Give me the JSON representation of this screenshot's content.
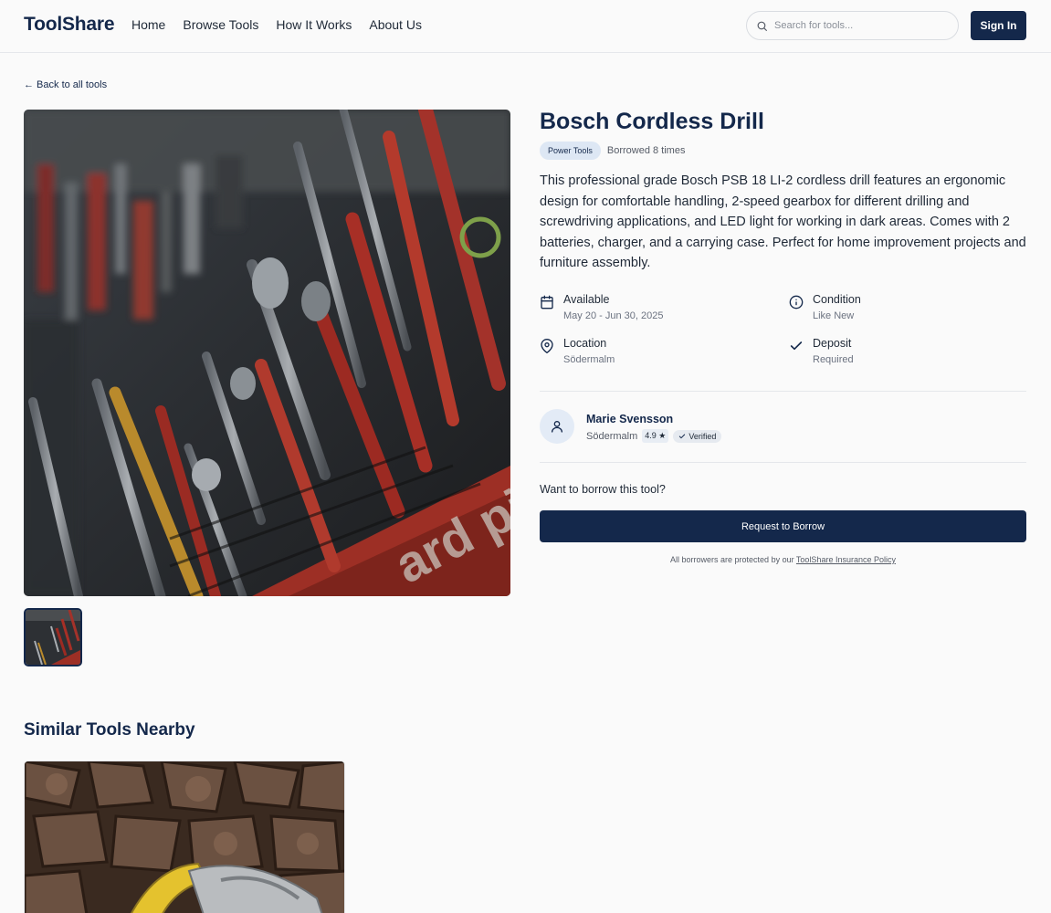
{
  "header": {
    "logo": "ToolShare",
    "nav": [
      {
        "label": "Home"
      },
      {
        "label": "Browse Tools"
      },
      {
        "label": "How It Works"
      },
      {
        "label": "About Us"
      }
    ],
    "search_placeholder": "Search for tools...",
    "sign_in": "Sign In"
  },
  "back_link": "← Back to all tools",
  "tool": {
    "title": "Bosch Cordless Drill",
    "category": "Power Tools",
    "borrowed": "Borrowed 8 times",
    "description": "This professional grade Bosch PSB 18 LI-2 cordless drill features an ergonomic design for comfortable handling, 2-speed gearbox for different drilling and screwdriving applications, and LED light for working in dark areas. Comes with 2 batteries, charger, and a carrying case. Perfect for home improvement projects and furniture assembly.",
    "features": {
      "available": {
        "label": "Available",
        "value": "May 20 - Jun 30, 2025",
        "icon": "calendar-icon"
      },
      "condition": {
        "label": "Condition",
        "value": "Like New",
        "icon": "info-icon"
      },
      "location": {
        "label": "Location",
        "value": "Södermalm",
        "icon": "map-pin-icon"
      },
      "deposit": {
        "label": "Deposit",
        "value": "Required",
        "icon": "check-icon"
      }
    }
  },
  "owner": {
    "name": "Marie Svensson",
    "location": "Södermalm",
    "rating": "4.9 ★",
    "verified": "Verified"
  },
  "borrow": {
    "prompt": "Want to borrow this tool?",
    "button": "Request to Borrow",
    "insurance_prefix": "All borrowers are protected by our ",
    "insurance_link": "ToolShare Insurance Policy"
  },
  "similar": {
    "title": "Similar Tools Nearby"
  },
  "colors": {
    "brand": "#14284b",
    "tag_bg": "#dde7f4"
  }
}
